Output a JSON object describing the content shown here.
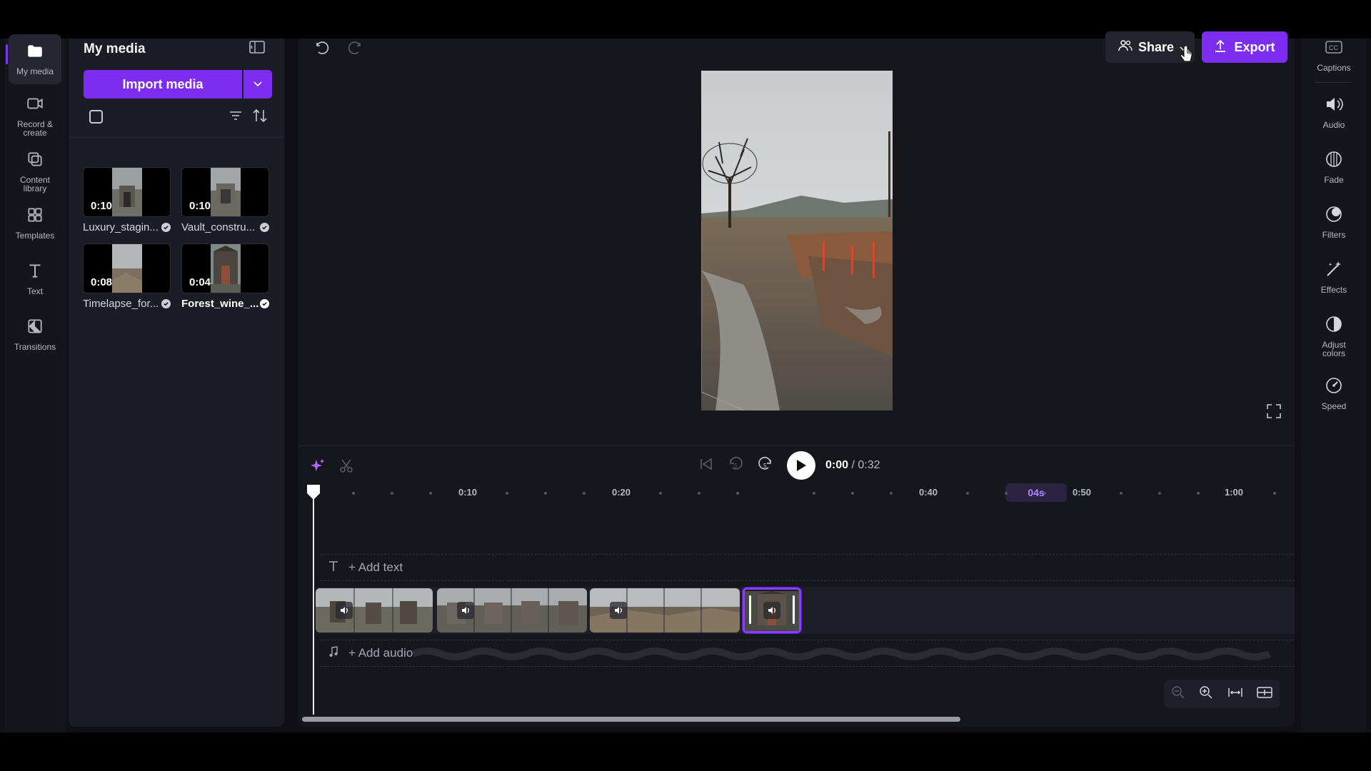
{
  "nav": {
    "items": [
      {
        "label": "My media",
        "icon": "folder-icon"
      },
      {
        "label": "Record & create",
        "icon": "camera-icon"
      },
      {
        "label": "Content library",
        "icon": "library-icon"
      },
      {
        "label": "Templates",
        "icon": "templates-icon"
      },
      {
        "label": "Text",
        "icon": "text-icon"
      },
      {
        "label": "Transitions",
        "icon": "transitions-icon"
      }
    ]
  },
  "media_panel": {
    "title": "My media",
    "import_label": "Import media",
    "items": [
      {
        "duration": "0:10",
        "name": "Luxury_stagin..."
      },
      {
        "duration": "0:10",
        "name": "Vault_constru..."
      },
      {
        "duration": "0:08",
        "name": "Timelapse_for..."
      },
      {
        "duration": "0:04",
        "name": "Forest_wine_..."
      }
    ]
  },
  "toolbar": {
    "share_label": "Share",
    "export_label": "Export"
  },
  "playback": {
    "current": "0:00",
    "total": "/ 0:32"
  },
  "ruler": {
    "labels": [
      "0:10",
      "0:20",
      "0:40",
      "0:50",
      "1:00"
    ],
    "hover_label": "04s"
  },
  "tracks": {
    "add_text": "+ Add text",
    "add_audio": "+ Add audio"
  },
  "properties": {
    "items": [
      {
        "label": "Captions",
        "icon": "captions-icon"
      },
      {
        "label": "Audio",
        "icon": "speaker-icon"
      },
      {
        "label": "Fade",
        "icon": "fade-icon"
      },
      {
        "label": "Filters",
        "icon": "filters-icon"
      },
      {
        "label": "Effects",
        "icon": "magic-wand-icon"
      },
      {
        "label": "Adjust colors",
        "icon": "contrast-icon"
      },
      {
        "label": "Speed",
        "icon": "speedometer-icon"
      }
    ]
  },
  "colors": {
    "accent": "#7c2df0",
    "background": "#101016"
  }
}
